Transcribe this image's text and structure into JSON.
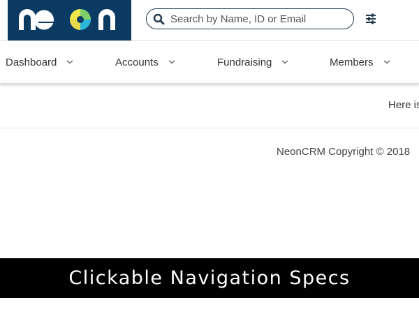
{
  "brand": {
    "logo_text": "neon",
    "bg_color": "#0b3a63"
  },
  "search": {
    "placeholder": "Search by Name, ID or Email",
    "icon": "search-icon"
  },
  "filter": {
    "icon": "sliders-icon"
  },
  "nav": {
    "items": [
      {
        "label": "Dashboard"
      },
      {
        "label": "Accounts"
      },
      {
        "label": "Fundraising"
      },
      {
        "label": "Members"
      }
    ]
  },
  "hero": {
    "text": "Here is"
  },
  "footer": {
    "copyright": "NeonCRM Copyright © 2018"
  },
  "banner": {
    "title": "Clickable Navigation Specs"
  }
}
